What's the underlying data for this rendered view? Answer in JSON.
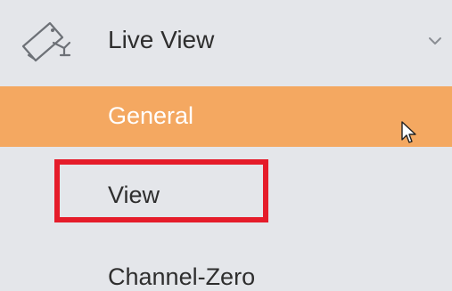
{
  "menu": {
    "header": {
      "icon": "camera-icon",
      "label": "Live View",
      "expand_icon": "chevron-down-icon"
    },
    "items": [
      {
        "label": "General",
        "state": "hovered"
      },
      {
        "label": "View",
        "state": "highlighted"
      },
      {
        "label": "Channel-Zero",
        "state": "normal"
      }
    ]
  },
  "colors": {
    "background": "#e4e6ea",
    "active_item": "#f4a861",
    "highlight_box": "#e51c2a",
    "text": "#2e2e2e"
  }
}
